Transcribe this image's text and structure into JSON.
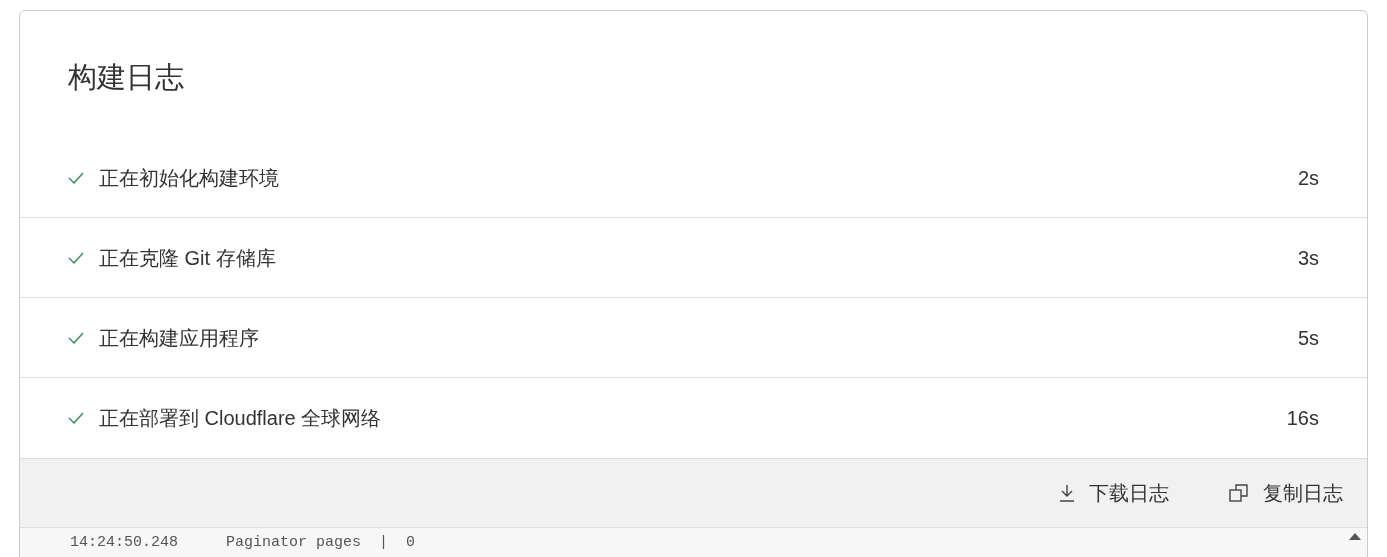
{
  "title": "构建日志",
  "steps": [
    {
      "label": "正在初始化构建环境",
      "done": true,
      "duration": "2s"
    },
    {
      "label": "正在克隆 Git 存储库",
      "done": true,
      "duration": "3s"
    },
    {
      "label": "正在构建应用程序",
      "done": true,
      "duration": "5s"
    },
    {
      "label": "正在部署到 Cloudflare 全球网络",
      "done": true,
      "duration": "16s"
    }
  ],
  "actions": [
    {
      "label": "下载日志",
      "kind": "download"
    },
    {
      "label": "复制日志",
      "kind": "copy"
    }
  ],
  "log_lines": [
    {
      "time": "14:24:50.248",
      "message": "Paginator pages  |  0"
    }
  ]
}
